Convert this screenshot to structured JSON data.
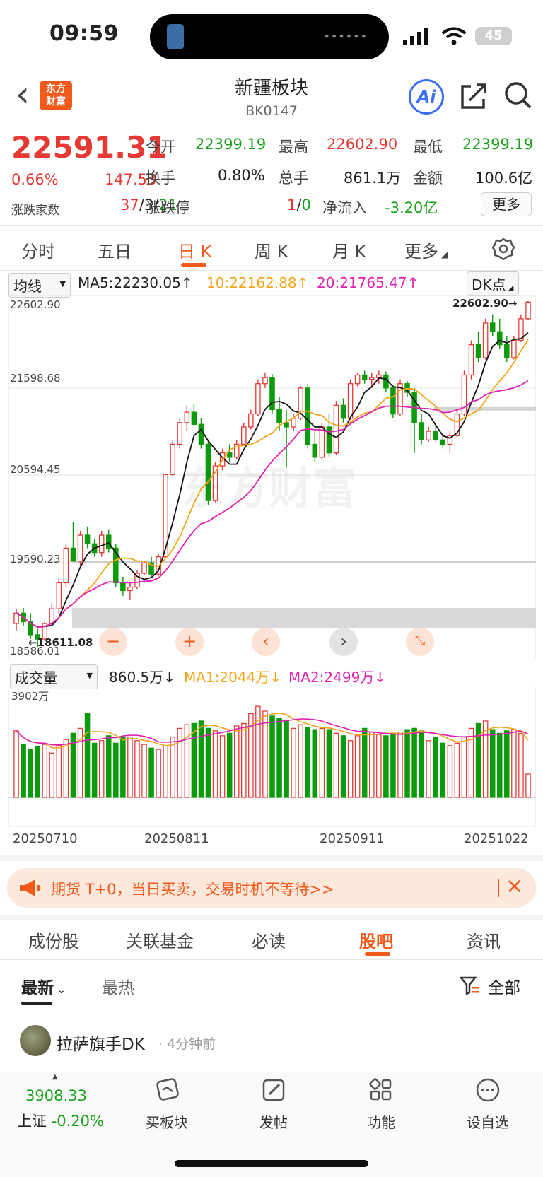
{
  "status": {
    "time": "09:59",
    "battery": "45"
  },
  "header": {
    "back": "‹",
    "logo": "东方\n财富",
    "title": "新疆板块",
    "code": "BK0147",
    "ai": "Ai"
  },
  "quote": {
    "price": "22591.31",
    "pct": "0.66%",
    "chg": "147.53",
    "open_label": "今开",
    "open": "22399.19",
    "high_label": "最高",
    "high": "22602.90",
    "low_label": "最低",
    "low": "22399.19",
    "turn_label": "换手",
    "turn": "0.80%",
    "vol_label": "总手",
    "vol": "861.1万",
    "amt_label": "金额",
    "amt": "100.6亿",
    "breadth_label": "涨跌家数",
    "breadth_up": "37",
    "breadth_flat": "3",
    "breadth_down": "21",
    "sep": "/",
    "limit_label": "涨跌停",
    "limit_up": "1",
    "limit_down": "0",
    "flow_label": "净流入",
    "flow": "-3.20亿",
    "more": "更多"
  },
  "tabs": [
    "分时",
    "五日",
    "日 K",
    "周 K",
    "月 K",
    "更多"
  ],
  "indicator": {
    "select": "均线",
    "ma5": "MA5:22230.05↑",
    "ma10": "10:22162.88↑",
    "ma20": "20:21765.47↑",
    "dk": "DK点"
  },
  "axis": {
    "y1": "22602.90",
    "y2": "21598.68",
    "y3": "20594.45",
    "y4": "19590.23",
    "y5": "18586.01",
    "hi_mark": "22602.90→",
    "lo_mark": "←18611.08",
    "watermark": "东方财富"
  },
  "volume": {
    "select": "成交量",
    "value": "860.5万↓",
    "ma1": "MA1:2044万↓",
    "ma2": "MA2:2499万↓",
    "max": "3902万",
    "dates": [
      "20250710",
      "20250811",
      "20250911",
      "20251022"
    ]
  },
  "banner": {
    "text": "期货 T+0，当日买卖，交易时机不等待>>",
    "close": "×"
  },
  "bottom_tabs": [
    "成份股",
    "关联基金",
    "必读",
    "股吧",
    "资讯"
  ],
  "feed": {
    "latest": "最新",
    "hot": "最热",
    "all": "全部",
    "user": "拉萨旗手DK",
    "time": "· 4分钟前"
  },
  "nav": {
    "index_value": "3908.33",
    "index_name": "上证",
    "index_pct": "-0.20%",
    "items": [
      "买板块",
      "发帖",
      "功能",
      "设自选"
    ]
  },
  "chart_data": {
    "type": "candlestick",
    "ylim": [
      18586.01,
      22602.9
    ],
    "colors": {
      "up": "#e53935",
      "down": "#0a9b0a",
      "ma5": "#111111",
      "ma10": "#f4a51c",
      "ma20": "#e020b0"
    },
    "ohlc": [
      [
        18880,
        19050,
        18800,
        19000
      ],
      [
        19000,
        19060,
        18850,
        18900
      ],
      [
        18900,
        19000,
        18700,
        18750
      ],
      [
        18750,
        18820,
        18611,
        18700
      ],
      [
        18700,
        18900,
        18680,
        18880
      ],
      [
        18880,
        19120,
        18850,
        19050
      ],
      [
        19050,
        19400,
        19000,
        19350
      ],
      [
        19350,
        19800,
        19300,
        19750
      ],
      [
        19750,
        20050,
        19700,
        19600
      ],
      [
        19600,
        19950,
        19550,
        19900
      ],
      [
        19900,
        20000,
        19750,
        19800
      ],
      [
        19800,
        19850,
        19650,
        19700
      ],
      [
        19700,
        19950,
        19650,
        19900
      ],
      [
        19900,
        19960,
        19700,
        19750
      ],
      [
        19750,
        19800,
        19300,
        19350
      ],
      [
        19350,
        19420,
        19200,
        19260
      ],
      [
        19260,
        19350,
        19150,
        19300
      ],
      [
        19300,
        19500,
        19280,
        19460
      ],
      [
        19460,
        19600,
        19440,
        19580
      ],
      [
        19580,
        19650,
        19420,
        19450
      ],
      [
        19450,
        19680,
        19430,
        19650
      ],
      [
        19650,
        20600,
        19640,
        20600
      ],
      [
        20600,
        21000,
        20580,
        20950
      ],
      [
        20950,
        21250,
        20900,
        21200
      ],
      [
        21200,
        21400,
        21100,
        21320
      ],
      [
        21320,
        21420,
        21150,
        21180
      ],
      [
        21180,
        21250,
        20900,
        20950
      ],
      [
        20950,
        21000,
        20250,
        20300
      ],
      [
        20300,
        20750,
        20280,
        20700
      ],
      [
        20700,
        20900,
        20650,
        20850
      ],
      [
        20850,
        20950,
        20750,
        20800
      ],
      [
        20800,
        21000,
        20780,
        20950
      ],
      [
        20950,
        21200,
        20930,
        21150
      ],
      [
        21150,
        21350,
        21120,
        21300
      ],
      [
        21300,
        21700,
        21280,
        21650
      ],
      [
        21650,
        21780,
        21600,
        21720
      ],
      [
        21720,
        21760,
        21300,
        21350
      ],
      [
        21350,
        21500,
        21100,
        21200
      ],
      [
        21200,
        21350,
        20680,
        21150
      ],
      [
        21150,
        21300,
        21100,
        21250
      ],
      [
        21250,
        21620,
        21230,
        21600
      ],
      [
        21600,
        21650,
        20900,
        20950
      ],
      [
        20950,
        21100,
        20750,
        20800
      ],
      [
        20800,
        21200,
        20780,
        21150
      ],
      [
        21150,
        21300,
        20800,
        20850
      ],
      [
        20850,
        21450,
        20830,
        21400
      ],
      [
        21400,
        21480,
        21200,
        21250
      ],
      [
        21250,
        21700,
        21230,
        21650
      ],
      [
        21650,
        21780,
        21620,
        21750
      ],
      [
        21750,
        21800,
        21650,
        21700
      ],
      [
        21700,
        21780,
        21600,
        21720
      ],
      [
        21720,
        21800,
        21650,
        21750
      ],
      [
        21750,
        21790,
        21550,
        21600
      ],
      [
        21600,
        21640,
        21250,
        21300
      ],
      [
        21300,
        21700,
        21280,
        21650
      ],
      [
        21650,
        21680,
        21500,
        21550
      ],
      [
        21550,
        21600,
        20850,
        21200
      ],
      [
        21200,
        21300,
        20950,
        21000
      ],
      [
        21000,
        21150,
        20980,
        21100
      ],
      [
        21100,
        21200,
        20980,
        21000
      ],
      [
        21000,
        21050,
        20900,
        20950
      ],
      [
        20950,
        21100,
        20850,
        21050
      ],
      [
        21050,
        21350,
        21030,
        21300
      ],
      [
        21300,
        21800,
        21280,
        21750
      ],
      [
        21750,
        22150,
        21700,
        22100
      ],
      [
        22100,
        22250,
        21900,
        21950
      ],
      [
        21950,
        22400,
        21930,
        22350
      ],
      [
        22350,
        22450,
        22200,
        22250
      ],
      [
        22250,
        22400,
        22050,
        22100
      ],
      [
        22100,
        22200,
        21900,
        21950
      ],
      [
        21950,
        22200,
        21930,
        22150
      ],
      [
        22150,
        22450,
        22130,
        22400
      ],
      [
        22400,
        22602.9,
        22390,
        22591.31
      ]
    ],
    "volume": [
      2700,
      2150,
      1950,
      2050,
      2150,
      1800,
      2100,
      2350,
      2600,
      2800,
      3400,
      2200,
      2300,
      2500,
      2200,
      2450,
      2450,
      2300,
      2150,
      2000,
      1950,
      2100,
      2450,
      2800,
      2950,
      3000,
      3100,
      2800,
      2700,
      2500,
      2600,
      2900,
      3000,
      3400,
      3700,
      3500,
      3300,
      3200,
      3100,
      2800,
      2950,
      2850,
      2750,
      2800,
      2750,
      2600,
      2500,
      2300,
      2500,
      2800,
      2650,
      2550,
      2500,
      2550,
      2650,
      2750,
      2800,
      2700,
      2300,
      2450,
      2200,
      2100,
      2200,
      2450,
      2800,
      3000,
      3100,
      2750,
      2600,
      2700,
      2750,
      2600,
      950
    ]
  }
}
